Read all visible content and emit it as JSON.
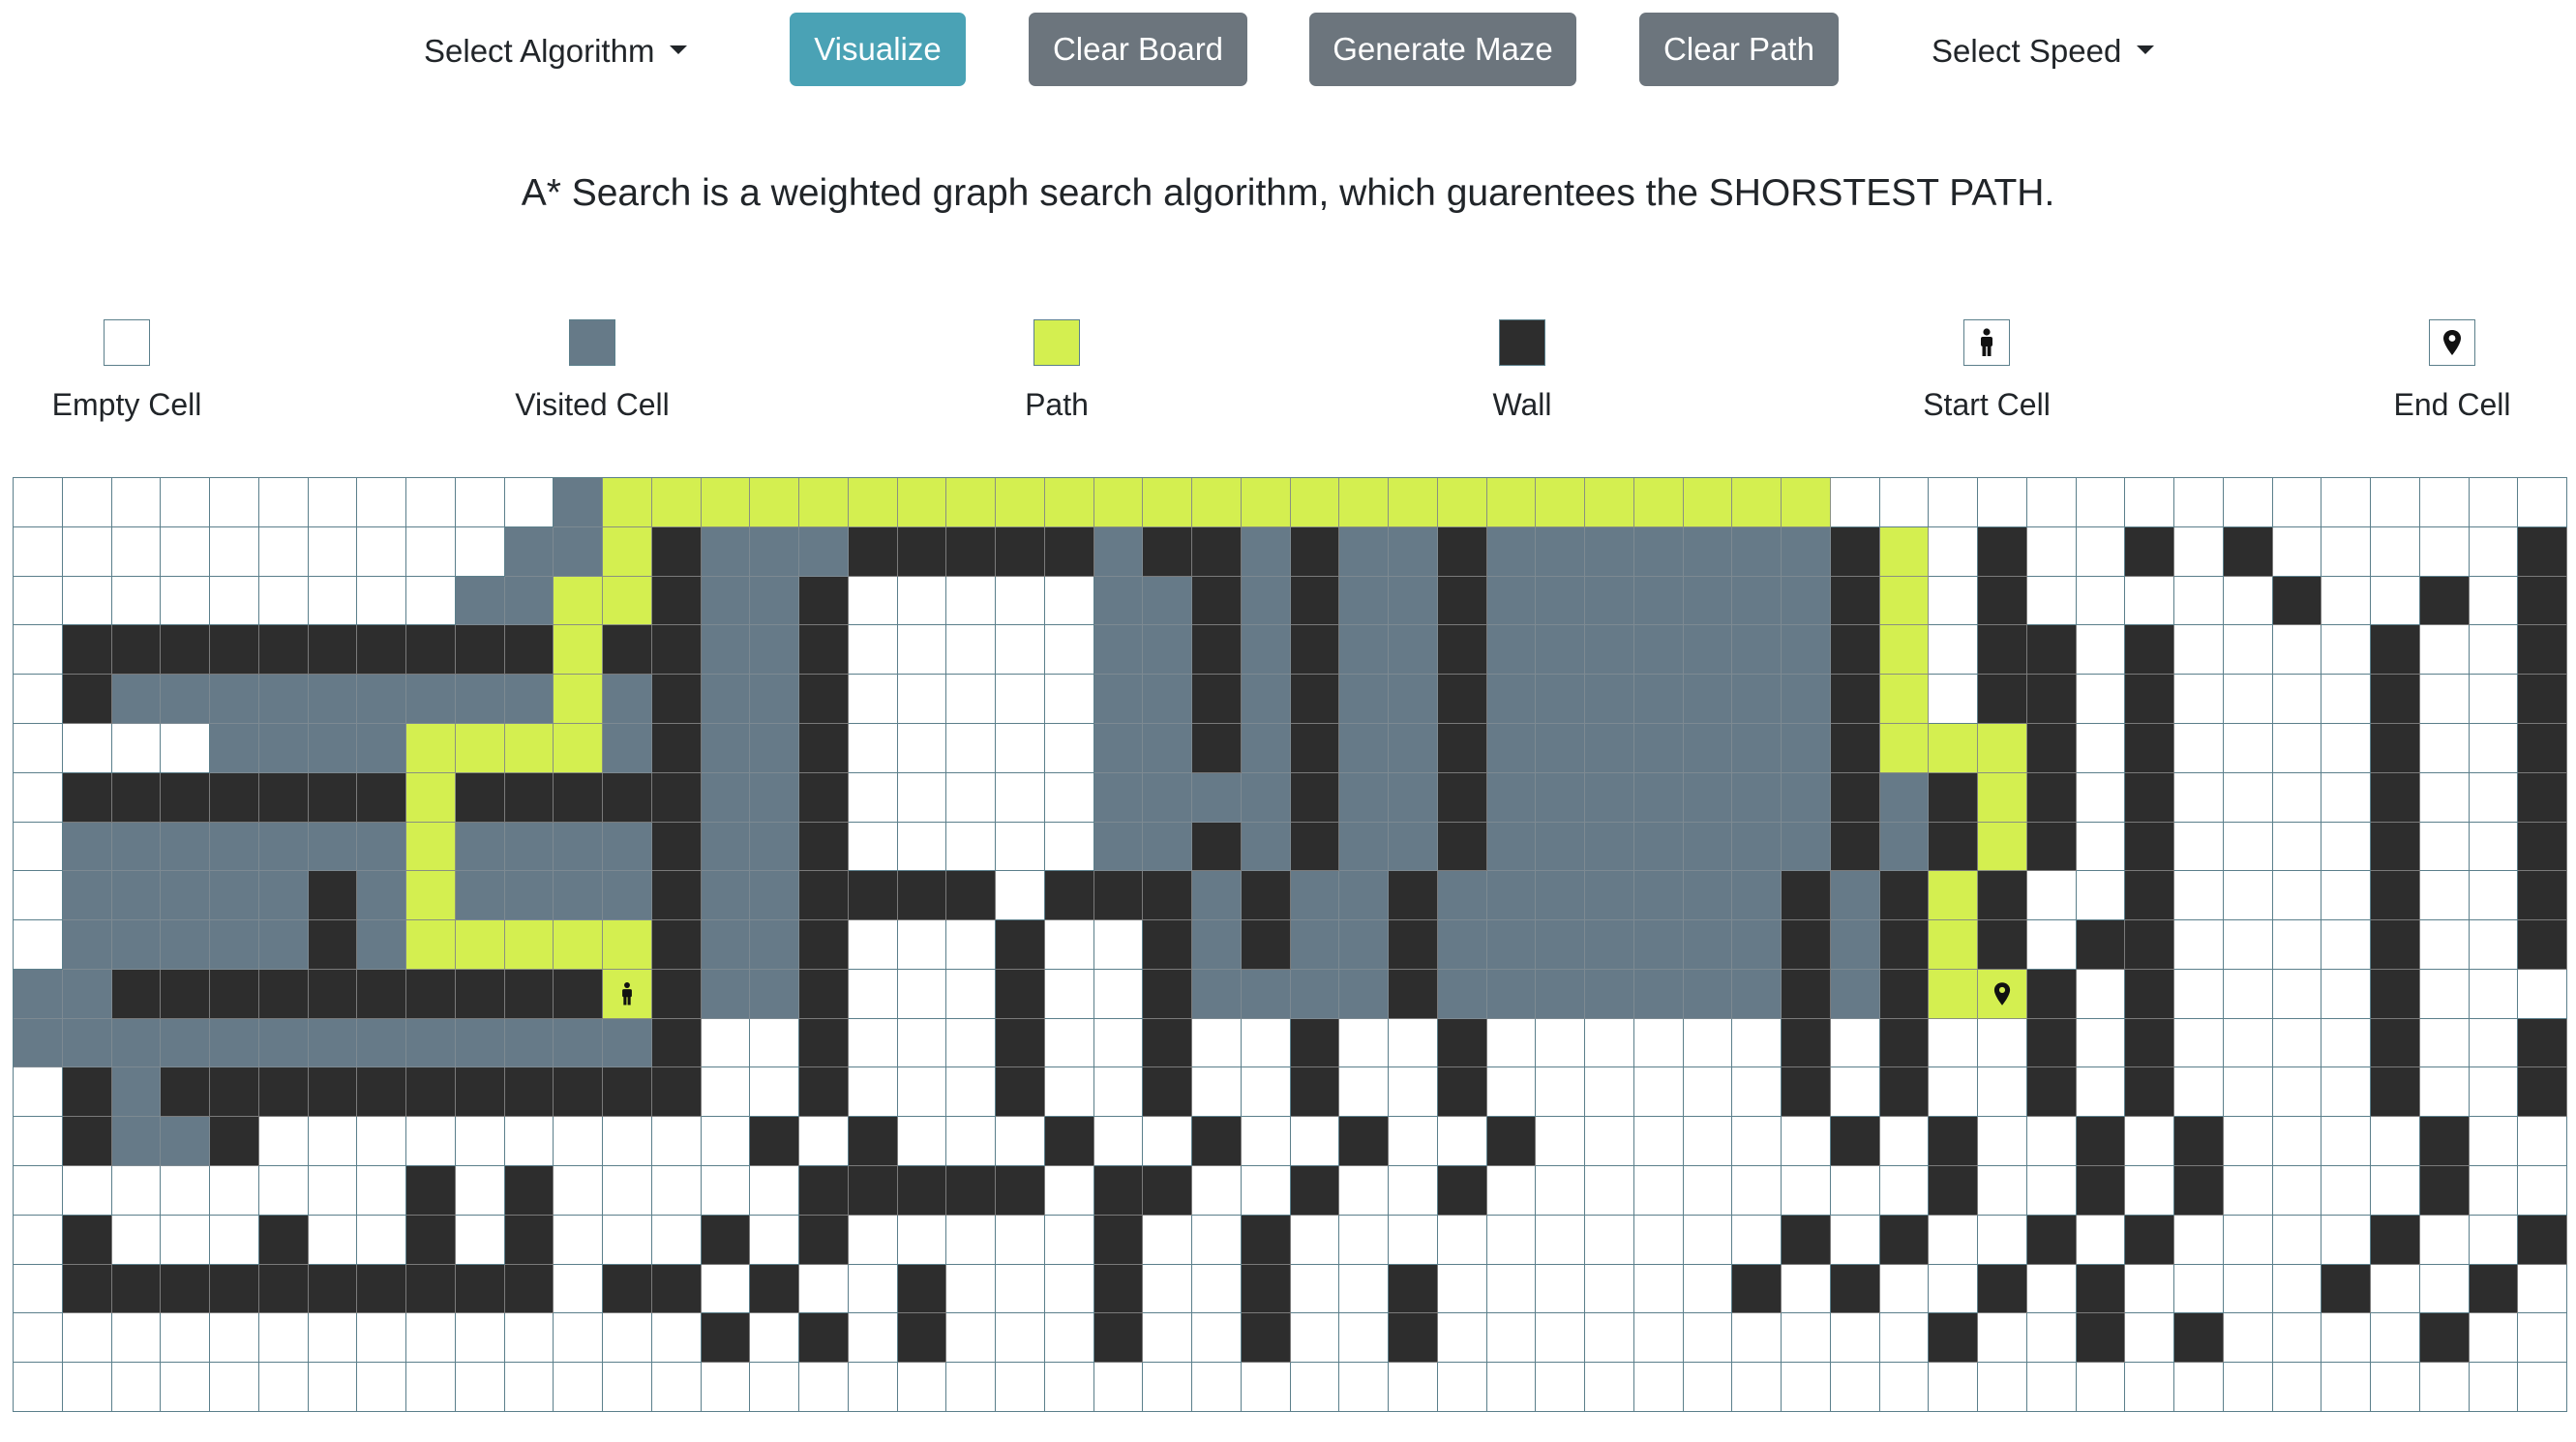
{
  "nav": {
    "select_algorithm": "Select Algorithm",
    "visualize": "Visualize",
    "clear_board": "Clear Board",
    "generate_maze": "Generate Maze",
    "clear_path": "Clear Path",
    "select_speed": "Select Speed"
  },
  "description": "A* Search is a weighted graph search algorithm, which guarentees the SHORSTEST PATH.",
  "legend": {
    "empty": "Empty Cell",
    "visited": "Visited Cell",
    "path": "Path",
    "wall": "Wall",
    "start": "Start Cell",
    "end": "End Cell"
  },
  "colors": {
    "empty": "#ffffff",
    "visited": "#667a88",
    "path": "#d4ef50",
    "wall": "#2d2d2d",
    "grid_line": "#5b7f8b",
    "visualize_button": "#4aa2b5",
    "secondary_button": "#6c757d"
  },
  "icons": {
    "start": "person-icon",
    "end": "map-pin-icon"
  },
  "grid": {
    "rows": [
      "...........VPPPPPPPPPPPPPPPPPPPPPPPPP...............",
      "..........VVPWVVVWWWWWVWWVWVVWVVVVVVVWP.W..W.W.....W.",
      ".........VVPPWVVW.....VVWVWVVWVVVVVVVWP.W.....W..W.W.",
      ".WWWWWWWWWWPWWVVW.....VVWVWVVWVVVVVVVWP.WW.W....W..W.",
      ".WVVVVVVVVVPVWVVW.....VVWVWVVWVVVVVVVWP.WW.W....W..W.",
      "....VVVVPPPPVWVVW.....VVWVWVVWVVVVVVVWPPPW.W....W..W.",
      ".WWWWWWWPWWWWWVVW.....VVVVWVVWVVVVVVVWVWPW.W....W..W.",
      ".VVVVVVVPVVVVWVVW.....VVWVWVVWVVVVVVVWVWPW.W....W..W.",
      ".VVVVVWVPVVVVWVVWWWW.WWWVWVVWVVVVVVVWVWPW..W....W..W.",
      ".VVVVVWVPPPPPWVVW...W..WVWVVWVVVVVVVWVWPW.WW....W..W.",
      "VVWWWWWWWWWWSWVVW...W..WVVVVWVVVVVVVWVWPEW.W....W....",
      "VVVVVVVVVVVVVW..W...W..W..W..W......W.W..W.W....W..W.",
      ".WVWWWWWWWWWWW..W...W..W..W..W......W.W..W.W....W..W.",
      ".WVVW..........W.W...W..W..W..W......W.W..W.W....W..W.",
      "........W.W.....WWWWW.WW..W..W.........W..W.W....W..W",
      ".W...W..W.W...W.W.....W..W..........W.W..W.W....W..W.",
      ".WWWWWWWWWW.WW.W..W...W..W..W......W.W..W.W....W..W..",
      "..............W.W.W...W..W..W..........W..W.W....W..W",
      "...................................................."
    ]
  }
}
